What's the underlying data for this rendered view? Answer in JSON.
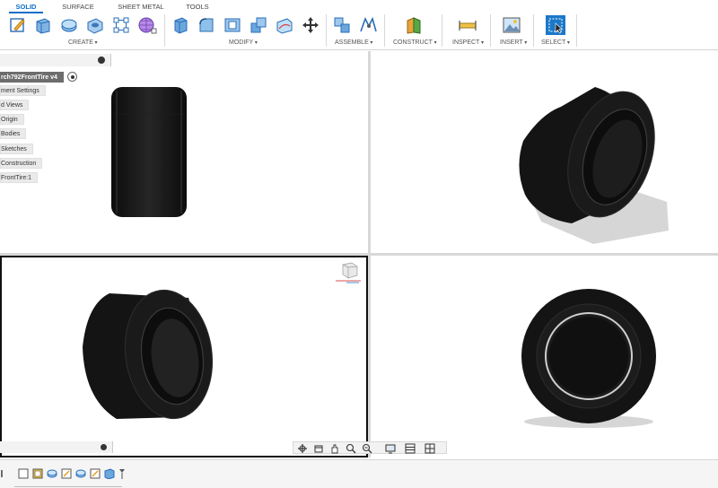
{
  "tabs": [
    {
      "label": "SOLID",
      "active": true
    },
    {
      "label": "SURFACE",
      "active": false
    },
    {
      "label": "SHEET METAL",
      "active": false
    },
    {
      "label": "TOOLS",
      "active": false
    }
  ],
  "groups": {
    "create": "CREATE",
    "modify": "MODIFY",
    "assemble": "ASSEMBLE",
    "construct": "CONSTRUCT",
    "inspect": "INSPECT",
    "insert": "INSERT",
    "select": "SELECT"
  },
  "browser": {
    "root": "rch792FrontTire v4",
    "items": [
      "ment Settings",
      "d Views",
      "Origin",
      "Bodies",
      "Sketches",
      "Construction",
      "FrontTire:1"
    ]
  },
  "icons": {
    "create": [
      "sketch-icon",
      "extrude-icon",
      "revolve-icon",
      "hole-icon",
      "pattern-icon",
      "form-icon"
    ],
    "modify": [
      "press-pull-icon",
      "fillet-icon",
      "shell-icon",
      "combine-icon",
      "surface-icon",
      "move-icon"
    ],
    "assemble": [
      "joint-icon",
      "as-built-joint-icon"
    ],
    "construct": [
      "plane-icon"
    ],
    "inspect": [
      "measure-icon"
    ],
    "insert": [
      "insert-image-icon"
    ],
    "select": [
      "select-icon"
    ]
  },
  "colors": {
    "accent": "#0b6fc7",
    "tire": "#151515",
    "shadow": "#d6d6d6"
  }
}
